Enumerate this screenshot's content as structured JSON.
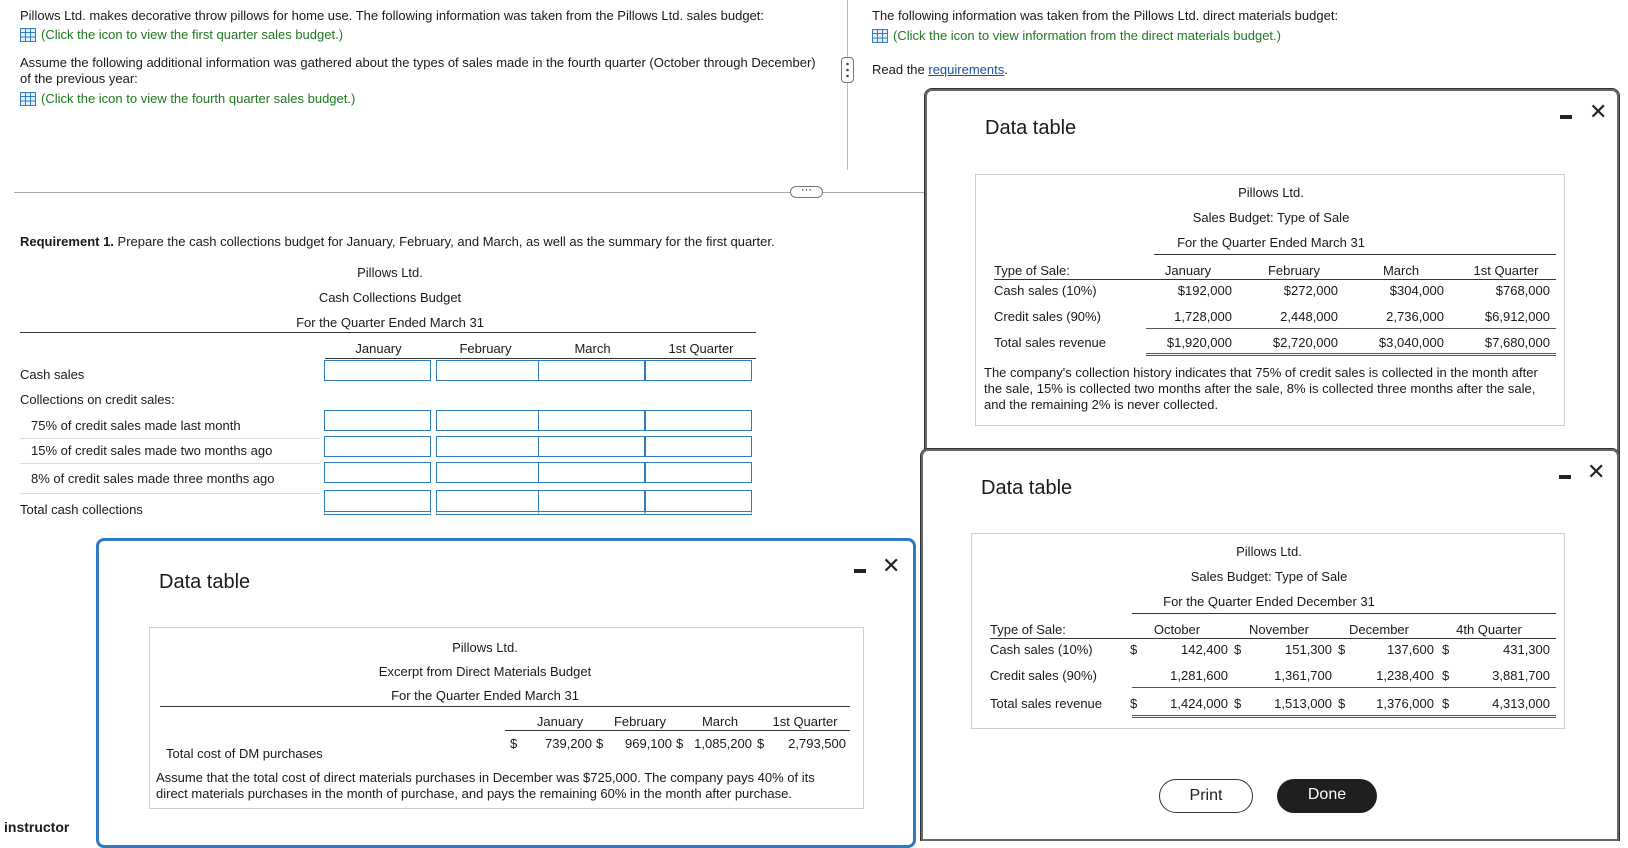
{
  "left": {
    "intro": "Pillows Ltd. makes decorative throw pillows for home use. The following information was taken from the Pillows Ltd. sales budget:",
    "link1": "(Click the icon to view the first quarter sales budget.)",
    "assume": "Assume the following additional information was gathered about the types of sales made in the fourth quarter (October through December) of the previous year:",
    "link2": "(Click the icon to view the fourth quarter sales budget.)",
    "req_bold": "Requirement 1.",
    "req_text": " Prepare the cash collections budget for January, February, and March, as well as the summary for the first quarter.",
    "budget": {
      "company": "Pillows Ltd.",
      "title": "Cash Collections Budget",
      "period": "For the Quarter Ended March 31",
      "cols": [
        "January",
        "February",
        "March",
        "1st Quarter"
      ],
      "rows": [
        "Cash sales",
        "Collections on credit sales:",
        "75% of credit sales made last month",
        "15% of credit sales made two months ago",
        "8% of credit sales made three months ago",
        "Total cash collections"
      ]
    },
    "instructor": "instructor"
  },
  "right": {
    "intro": "The following information was taken from the Pillows Ltd. direct materials budget:",
    "link": "(Click the icon to view information from the direct materials budget.)",
    "read_prefix": "Read the ",
    "read_link": "requirements",
    "read_suffix": "."
  },
  "popup_dm": {
    "title": "Data table",
    "company": "Pillows Ltd.",
    "subtitle": "Excerpt from Direct Materials Budget",
    "period": "For the Quarter Ended March 31",
    "cols": [
      "January",
      "February",
      "March",
      "1st Quarter"
    ],
    "row_label": "Total cost of DM purchases",
    "dollar": "$",
    "values": [
      "739,200",
      "969,100",
      "1,085,200",
      "2,793,500"
    ],
    "note": "Assume that the total cost of direct materials purchases in December was $725,000. The company pays 40% of its direct materials purchases in the month of purchase, and pays the remaining 60% in the month after purchase."
  },
  "popup_q1": {
    "title": "Data table",
    "company": "Pillows Ltd.",
    "subtitle": "Sales Budget: Type of Sale",
    "period": "For the Quarter Ended March 31",
    "type_label": "Type of Sale:",
    "cols": [
      "January",
      "February",
      "March",
      "1st Quarter"
    ],
    "rows": [
      {
        "label": "Cash sales (10%)",
        "values": [
          "$192,000",
          "$272,000",
          "$304,000",
          "$768,000"
        ]
      },
      {
        "label": "Credit sales (90%)",
        "values": [
          "1,728,000",
          "2,448,000",
          "2,736,000",
          "$6,912,000"
        ]
      },
      {
        "label": "Total sales revenue",
        "values": [
          "$1,920,000",
          "$2,720,000",
          "$3,040,000",
          "$7,680,000"
        ]
      }
    ],
    "note": "The company's collection history indicates that 75% of credit sales is collected in the month after the sale, 15% is collected two months after the sale, 8% is collected three months after the sale, and the remaining 2% is never collected."
  },
  "popup_q4": {
    "title": "Data table",
    "company": "Pillows Ltd.",
    "subtitle": "Sales Budget: Type of Sale",
    "period": "For the Quarter Ended December 31",
    "type_label": "Type of Sale:",
    "cols": [
      "October",
      "November",
      "December",
      "4th Quarter"
    ],
    "dollar": "$",
    "rows": [
      {
        "label": "Cash sales (10%)",
        "values": [
          "142,400",
          "151,300",
          "137,600",
          "431,300"
        ]
      },
      {
        "label": "Credit sales (90%)",
        "values": [
          "1,281,600",
          "1,361,700",
          "1,238,400",
          "3,881,700"
        ]
      },
      {
        "label": "Total sales revenue",
        "values": [
          "1,424,000",
          "1,513,000",
          "1,376,000",
          "4,313,000"
        ]
      }
    ],
    "print": "Print",
    "done": "Done"
  },
  "colors": {
    "accent": "#2f7bbf",
    "link_green": "#1f7a1f",
    "done_bg": "#1f1f1f"
  }
}
